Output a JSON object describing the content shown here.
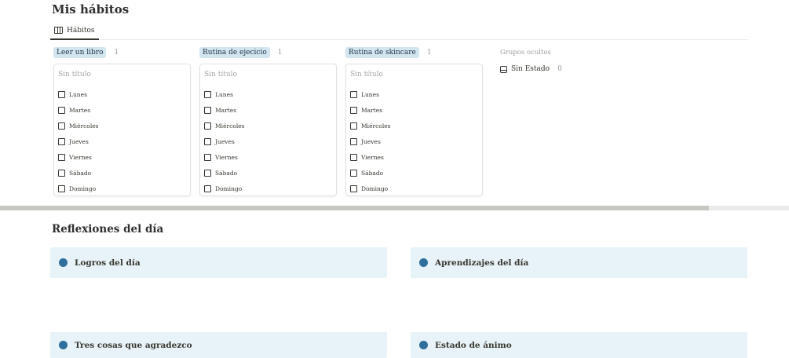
{
  "title": "Mis hábitos",
  "tab": {
    "label": "Hábitos",
    "icon": "board-view-icon"
  },
  "groups": [
    {
      "name": "Leer un libro",
      "count": "1",
      "card_title": "Sin título",
      "days": [
        "Lunes",
        "Martes",
        "Miércoles",
        "Jueves",
        "Viernes",
        "Sábado",
        "Domingo"
      ]
    },
    {
      "name": "Rutina de ejecicio",
      "count": "1",
      "card_title": "Sin título",
      "days": [
        "Lunes",
        "Martes",
        "Miércoles",
        "Jueves",
        "Viernes",
        "Sábado",
        "Domingo"
      ]
    },
    {
      "name": "Rutina de skincare",
      "count": "1",
      "card_title": "Sin título",
      "days": [
        "Lunes",
        "Martes",
        "Miércoles",
        "Jueves",
        "Viernes",
        "Sábado",
        "Domingo"
      ]
    }
  ],
  "hidden_groups": {
    "title": "Grupos ocultos",
    "item": {
      "label": "Sin Estado",
      "count": "0",
      "icon": "inbox-icon"
    }
  },
  "reflections": {
    "title": "Reflexiones del día",
    "callouts": [
      "Logros del día",
      "Aprendizajes del día",
      "Tres cosas que agradezco",
      "Estado de ánimo"
    ]
  },
  "colors": {
    "group_pill_bg": "#d3e5ef",
    "callout_bg": "#e7f3f8",
    "dot": "#2e6f9e"
  }
}
